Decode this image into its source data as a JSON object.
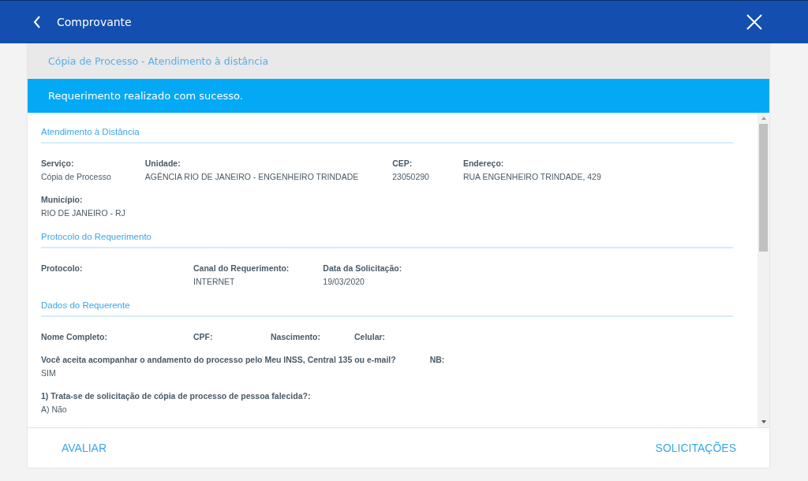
{
  "header": {
    "title": "Comprovante"
  },
  "subtitle": "Cópia de Processo - Atendimento à distância",
  "alert": "Requerimento realizado com sucesso.",
  "sections": [
    {
      "title": "Atendimento à Distância",
      "lines": [
        {
          "fields": [
            {
              "label": "Serviço:",
              "value": "Cópia de Processo"
            },
            {
              "label": "Unidade:",
              "value": "AGÊNCIA RIO DE JANEIRO - ENGENHEIRO TRINDADE"
            },
            {
              "label": "CEP:",
              "value": "23050290"
            },
            {
              "label": "Endereço:",
              "value": "RUA ENGENHEIRO TRINDADE, 429"
            }
          ]
        },
        {
          "fields": [
            {
              "label": "Município:",
              "value": "RIO DE JANEIRO - RJ"
            }
          ]
        }
      ]
    },
    {
      "title": "Protocolo do Requerimento",
      "lines": [
        {
          "fields": [
            {
              "label": "Protocolo:"
            },
            {
              "label": "Canal do Requerimento:",
              "value": "INTERNET"
            },
            {
              "label": "Data da Solicitação:",
              "value": "19/03/2020"
            }
          ]
        }
      ]
    },
    {
      "title": "Dados do Requerente",
      "lines": [
        {
          "fields": [
            {
              "label": "Nome Completo:"
            },
            {
              "label": "CPF:"
            },
            {
              "label": "Nascimento:"
            },
            {
              "label": "Celular:"
            }
          ]
        },
        {
          "fields": [
            {
              "label": "Você aceita acompanhar o andamento do processo pelo Meu INSS, Central 135 ou e-mail?",
              "value": "SIM"
            },
            {
              "label": "NB:"
            }
          ]
        },
        {
          "fields": [
            {
              "label": "1) Trata-se de solicitação de cópia de processo de pessoa falecida?:",
              "value": "A) Não"
            }
          ]
        }
      ]
    }
  ],
  "footer": {
    "left": "AVALIAR",
    "right": "SOLICITAÇÕES"
  }
}
